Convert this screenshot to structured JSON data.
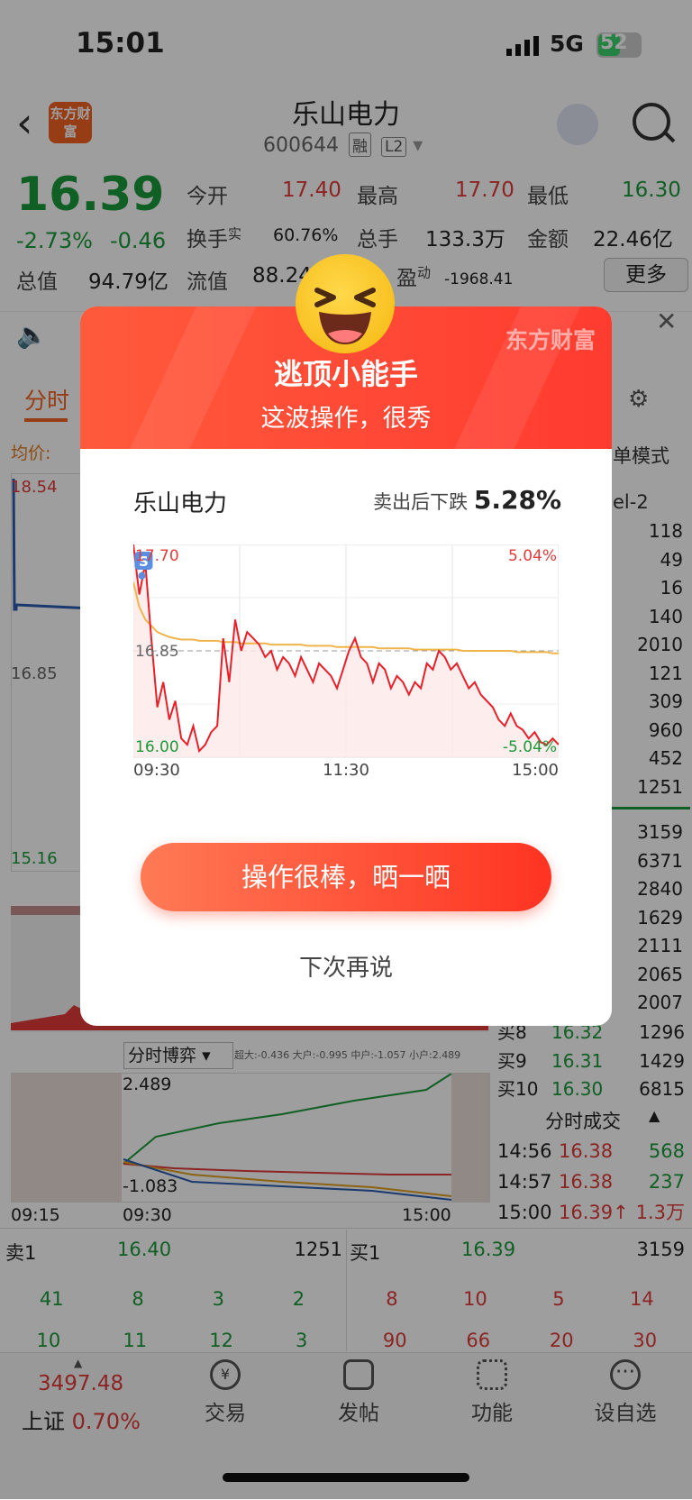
{
  "status_bar": {
    "time": "15:01",
    "network": "5G",
    "battery": "52"
  },
  "header": {
    "logo": "东方财富",
    "title": "乐山电力",
    "code": "600644",
    "tag1": "融",
    "tag2": "L2"
  },
  "quote": {
    "price": "16.39",
    "pct": "-2.73%",
    "chg": "-0.46",
    "open_label": "今开",
    "open": "17.40",
    "high_label": "最高",
    "high": "17.70",
    "low_label": "最低",
    "low": "16.30",
    "turnover_label": "换手",
    "turnover_sup": "实",
    "turnover": "60.76%",
    "volume_label": "总手",
    "volume": "133.3万",
    "amount_label": "金额",
    "amount": "22.46亿",
    "mktcap_label": "总值",
    "mktcap": "94.79亿",
    "float_label": "流值",
    "float": "88.24",
    "pe_label": "盈",
    "pe_sup": "动",
    "pe": "-1968.41",
    "more": "更多"
  },
  "tabs": {
    "active": "分时",
    "avg_label": "均价:",
    "mode": "单模式",
    "level": "el-2"
  },
  "left_chart": {
    "high": "18.54",
    "mid": "16.85",
    "low": "15.16"
  },
  "depth_right": [
    "118",
    "49",
    "16",
    "140",
    "2010",
    "121",
    "309",
    "960",
    "452",
    "1251"
  ],
  "depth_buy": [
    "3159",
    "6371",
    "2840",
    "1629",
    "2111",
    "2065",
    "2007"
  ],
  "buy_levels": [
    {
      "label": "买8",
      "price": "16.32",
      "vol": "1296"
    },
    {
      "label": "买9",
      "price": "16.31",
      "vol": "1429"
    },
    {
      "label": "买10",
      "price": "16.30",
      "vol": "6815"
    }
  ],
  "bottom_chart": {
    "selector": "分时博弈",
    "legend": "超大:-0.436 大户:-0.995 中户:-1.057 小户:2.489",
    "top": "2.489",
    "bottom": "-1.083",
    "t_start": "09:15",
    "t_open": "09:30",
    "t_close": "15:00"
  },
  "trades": {
    "title": "分时成交",
    "rows": [
      {
        "time": "14:56",
        "price": "16.38",
        "vol": "568"
      },
      {
        "time": "14:57",
        "price": "16.38",
        "vol": "237"
      },
      {
        "time": "15:00",
        "price": "16.39↑",
        "vol": "1.3万"
      }
    ]
  },
  "order_book": {
    "sell1_label": "卖1",
    "sell1_price": "16.40",
    "sell1_vol": "1251",
    "buy1_label": "买1",
    "buy1_price": "16.39",
    "buy1_vol": "3159",
    "sell_queue": [
      [
        "41",
        "8",
        "3",
        "2"
      ],
      [
        "10",
        "11",
        "12",
        "3"
      ]
    ],
    "buy_queue": [
      [
        "8",
        "10",
        "5",
        "14"
      ],
      [
        "90",
        "66",
        "20",
        "30"
      ]
    ]
  },
  "index": {
    "value": "3497.48",
    "name": "上证",
    "pct": "0.70%"
  },
  "nav": {
    "trade": "交易",
    "post": "发帖",
    "func": "功能",
    "watch": "设自选"
  },
  "modal": {
    "brand": "东方财富",
    "title": "逃顶小能手",
    "subtitle": "这波操作，很秀",
    "stock": "乐山电力",
    "fall_label": "卖出后下跌",
    "fall_value": "5.28%",
    "cta": "操作很棒，晒一晒",
    "later": "下次再说"
  },
  "chart_data": {
    "type": "line",
    "ylim": [
      16.0,
      17.7
    ],
    "y_labels": {
      "top_left": "17.70",
      "mid": "16.85",
      "bottom_left": "16.00",
      "top_right": "5.04%",
      "bottom_right": "-5.04%"
    },
    "x_ticks": [
      "09:30",
      "11:30",
      "15:00"
    ],
    "marker": {
      "label": "S",
      "x": 0.02,
      "y": 17.45
    },
    "series": [
      {
        "values": [
          17.7,
          17.3,
          17.55,
          16.95,
          16.4,
          16.6,
          16.3,
          16.45,
          16.15,
          16.1,
          16.25,
          16.05,
          16.1,
          16.2,
          16.25,
          16.95,
          16.6,
          17.1,
          16.85,
          17.0,
          16.95,
          16.9,
          16.8,
          16.85,
          16.7,
          16.8,
          16.75,
          16.65,
          16.8,
          16.7,
          16.6,
          16.75,
          16.7,
          16.65,
          16.55,
          16.7,
          16.85,
          16.95,
          16.8,
          16.75,
          16.6,
          16.75,
          16.7,
          16.55,
          16.65,
          16.6,
          16.5,
          16.6,
          16.55,
          16.75,
          16.7,
          16.85,
          16.8,
          16.7,
          16.75,
          16.65,
          16.55,
          16.6,
          16.5,
          16.45,
          16.4,
          16.3,
          16.25,
          16.35,
          16.25,
          16.22,
          16.15,
          16.2,
          16.12,
          16.1,
          16.15,
          16.1
        ]
      },
      {
        "values": [
          17.4,
          17.2,
          17.1,
          17.05,
          17.0,
          16.98,
          16.96,
          16.95,
          16.94,
          16.94,
          16.94,
          16.93,
          16.93,
          16.93,
          16.93,
          16.92,
          16.92,
          16.92,
          16.91,
          16.91,
          16.91,
          16.91,
          16.91,
          16.9,
          16.9,
          16.9,
          16.9,
          16.9,
          16.9,
          16.89,
          16.89,
          16.89,
          16.89,
          16.89,
          16.88,
          16.88,
          16.88,
          16.88,
          16.88,
          16.88,
          16.88,
          16.87,
          16.87,
          16.87,
          16.87,
          16.87,
          16.87,
          16.86,
          16.86,
          16.86,
          16.86,
          16.86,
          16.86,
          16.86,
          16.86,
          16.85,
          16.85,
          16.85,
          16.85,
          16.85,
          16.85,
          16.85,
          16.85,
          16.85,
          16.84,
          16.84,
          16.84,
          16.84,
          16.84,
          16.84,
          16.83,
          16.83
        ]
      }
    ]
  }
}
